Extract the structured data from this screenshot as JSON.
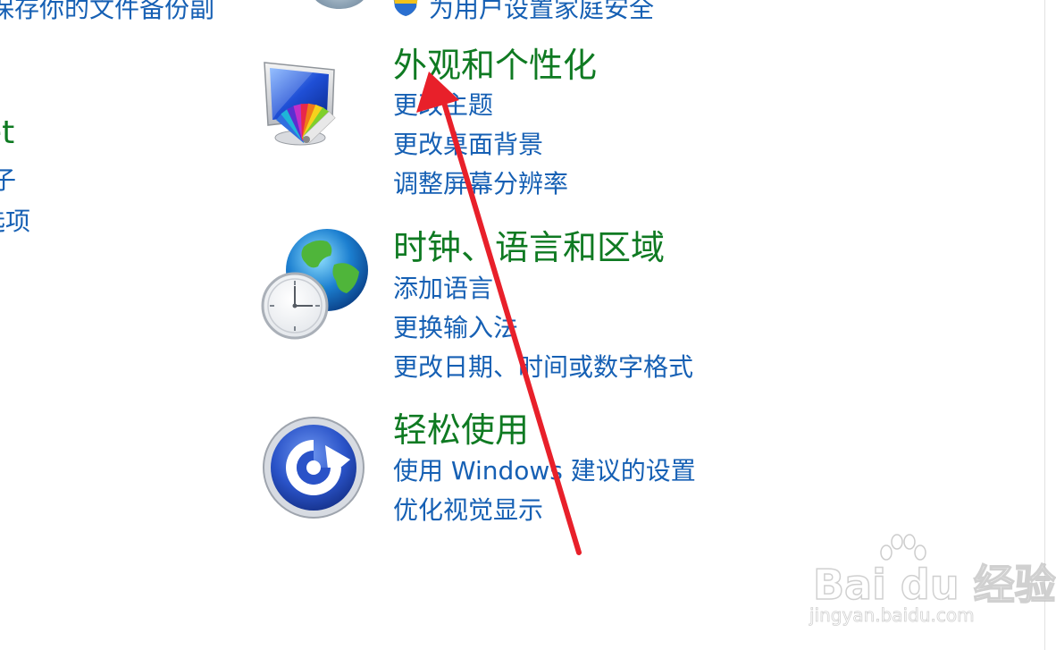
{
  "top_row": {
    "left_link": "保存你的文件备份副",
    "right_link": "为用户设置家庭安全"
  },
  "left_column": {
    "heading": "et",
    "link_1": "子",
    "link_2": "选项"
  },
  "categories": [
    {
      "title": "外观和个性化",
      "icon": "appearance-personalization-icon",
      "links": [
        "更改主题",
        "更改桌面背景",
        "调整屏幕分辨率"
      ]
    },
    {
      "title": "时钟、语言和区域",
      "icon": "clock-language-region-icon",
      "links": [
        "添加语言",
        "更换输入法",
        "更改日期、时间或数字格式"
      ]
    },
    {
      "title": "轻松使用",
      "icon": "ease-of-access-icon",
      "links": [
        "使用 Windows 建议的设置",
        "优化视觉显示"
      ]
    }
  ],
  "annotation": {
    "arrow_color": "#e8202a",
    "arrow_icon": "red-annotation-arrow"
  },
  "watermark": {
    "main": "Bai du 经验",
    "sub": "jingyan.baidu.com"
  },
  "colors": {
    "heading_green": "#0f7a22",
    "link_blue": "#1660b4"
  }
}
